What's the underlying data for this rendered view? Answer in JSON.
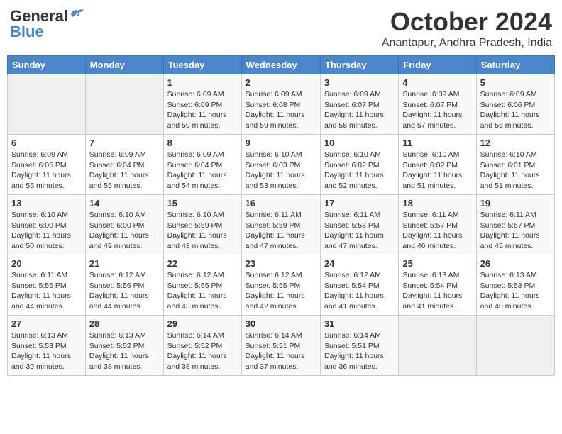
{
  "header": {
    "logo_general": "General",
    "logo_blue": "Blue",
    "month_title": "October 2024",
    "location": "Anantapur, Andhra Pradesh, India"
  },
  "weekdays": [
    "Sunday",
    "Monday",
    "Tuesday",
    "Wednesday",
    "Thursday",
    "Friday",
    "Saturday"
  ],
  "weeks": [
    [
      {
        "day": "",
        "sunrise": "",
        "sunset": "",
        "daylight": ""
      },
      {
        "day": "",
        "sunrise": "",
        "sunset": "",
        "daylight": ""
      },
      {
        "day": "1",
        "sunrise": "Sunrise: 6:09 AM",
        "sunset": "Sunset: 6:09 PM",
        "daylight": "Daylight: 11 hours and 59 minutes."
      },
      {
        "day": "2",
        "sunrise": "Sunrise: 6:09 AM",
        "sunset": "Sunset: 6:08 PM",
        "daylight": "Daylight: 11 hours and 59 minutes."
      },
      {
        "day": "3",
        "sunrise": "Sunrise: 6:09 AM",
        "sunset": "Sunset: 6:07 PM",
        "daylight": "Daylight: 11 hours and 58 minutes."
      },
      {
        "day": "4",
        "sunrise": "Sunrise: 6:09 AM",
        "sunset": "Sunset: 6:07 PM",
        "daylight": "Daylight: 11 hours and 57 minutes."
      },
      {
        "day": "5",
        "sunrise": "Sunrise: 6:09 AM",
        "sunset": "Sunset: 6:06 PM",
        "daylight": "Daylight: 11 hours and 56 minutes."
      }
    ],
    [
      {
        "day": "6",
        "sunrise": "Sunrise: 6:09 AM",
        "sunset": "Sunset: 6:05 PM",
        "daylight": "Daylight: 11 hours and 55 minutes."
      },
      {
        "day": "7",
        "sunrise": "Sunrise: 6:09 AM",
        "sunset": "Sunset: 6:04 PM",
        "daylight": "Daylight: 11 hours and 55 minutes."
      },
      {
        "day": "8",
        "sunrise": "Sunrise: 6:09 AM",
        "sunset": "Sunset: 6:04 PM",
        "daylight": "Daylight: 11 hours and 54 minutes."
      },
      {
        "day": "9",
        "sunrise": "Sunrise: 6:10 AM",
        "sunset": "Sunset: 6:03 PM",
        "daylight": "Daylight: 11 hours and 53 minutes."
      },
      {
        "day": "10",
        "sunrise": "Sunrise: 6:10 AM",
        "sunset": "Sunset: 6:02 PM",
        "daylight": "Daylight: 11 hours and 52 minutes."
      },
      {
        "day": "11",
        "sunrise": "Sunrise: 6:10 AM",
        "sunset": "Sunset: 6:02 PM",
        "daylight": "Daylight: 11 hours and 51 minutes."
      },
      {
        "day": "12",
        "sunrise": "Sunrise: 6:10 AM",
        "sunset": "Sunset: 6:01 PM",
        "daylight": "Daylight: 11 hours and 51 minutes."
      }
    ],
    [
      {
        "day": "13",
        "sunrise": "Sunrise: 6:10 AM",
        "sunset": "Sunset: 6:00 PM",
        "daylight": "Daylight: 11 hours and 50 minutes."
      },
      {
        "day": "14",
        "sunrise": "Sunrise: 6:10 AM",
        "sunset": "Sunset: 6:00 PM",
        "daylight": "Daylight: 11 hours and 49 minutes."
      },
      {
        "day": "15",
        "sunrise": "Sunrise: 6:10 AM",
        "sunset": "Sunset: 5:59 PM",
        "daylight": "Daylight: 11 hours and 48 minutes."
      },
      {
        "day": "16",
        "sunrise": "Sunrise: 6:11 AM",
        "sunset": "Sunset: 5:59 PM",
        "daylight": "Daylight: 11 hours and 47 minutes."
      },
      {
        "day": "17",
        "sunrise": "Sunrise: 6:11 AM",
        "sunset": "Sunset: 5:58 PM",
        "daylight": "Daylight: 11 hours and 47 minutes."
      },
      {
        "day": "18",
        "sunrise": "Sunrise: 6:11 AM",
        "sunset": "Sunset: 5:57 PM",
        "daylight": "Daylight: 11 hours and 46 minutes."
      },
      {
        "day": "19",
        "sunrise": "Sunrise: 6:11 AM",
        "sunset": "Sunset: 5:57 PM",
        "daylight": "Daylight: 11 hours and 45 minutes."
      }
    ],
    [
      {
        "day": "20",
        "sunrise": "Sunrise: 6:11 AM",
        "sunset": "Sunset: 5:56 PM",
        "daylight": "Daylight: 11 hours and 44 minutes."
      },
      {
        "day": "21",
        "sunrise": "Sunrise: 6:12 AM",
        "sunset": "Sunset: 5:56 PM",
        "daylight": "Daylight: 11 hours and 44 minutes."
      },
      {
        "day": "22",
        "sunrise": "Sunrise: 6:12 AM",
        "sunset": "Sunset: 5:55 PM",
        "daylight": "Daylight: 11 hours and 43 minutes."
      },
      {
        "day": "23",
        "sunrise": "Sunrise: 6:12 AM",
        "sunset": "Sunset: 5:55 PM",
        "daylight": "Daylight: 11 hours and 42 minutes."
      },
      {
        "day": "24",
        "sunrise": "Sunrise: 6:12 AM",
        "sunset": "Sunset: 5:54 PM",
        "daylight": "Daylight: 11 hours and 41 minutes."
      },
      {
        "day": "25",
        "sunrise": "Sunrise: 6:13 AM",
        "sunset": "Sunset: 5:54 PM",
        "daylight": "Daylight: 11 hours and 41 minutes."
      },
      {
        "day": "26",
        "sunrise": "Sunrise: 6:13 AM",
        "sunset": "Sunset: 5:53 PM",
        "daylight": "Daylight: 11 hours and 40 minutes."
      }
    ],
    [
      {
        "day": "27",
        "sunrise": "Sunrise: 6:13 AM",
        "sunset": "Sunset: 5:53 PM",
        "daylight": "Daylight: 11 hours and 39 minutes."
      },
      {
        "day": "28",
        "sunrise": "Sunrise: 6:13 AM",
        "sunset": "Sunset: 5:52 PM",
        "daylight": "Daylight: 11 hours and 38 minutes."
      },
      {
        "day": "29",
        "sunrise": "Sunrise: 6:14 AM",
        "sunset": "Sunset: 5:52 PM",
        "daylight": "Daylight: 11 hours and 38 minutes."
      },
      {
        "day": "30",
        "sunrise": "Sunrise: 6:14 AM",
        "sunset": "Sunset: 5:51 PM",
        "daylight": "Daylight: 11 hours and 37 minutes."
      },
      {
        "day": "31",
        "sunrise": "Sunrise: 6:14 AM",
        "sunset": "Sunset: 5:51 PM",
        "daylight": "Daylight: 11 hours and 36 minutes."
      },
      {
        "day": "",
        "sunrise": "",
        "sunset": "",
        "daylight": ""
      },
      {
        "day": "",
        "sunrise": "",
        "sunset": "",
        "daylight": ""
      }
    ]
  ]
}
